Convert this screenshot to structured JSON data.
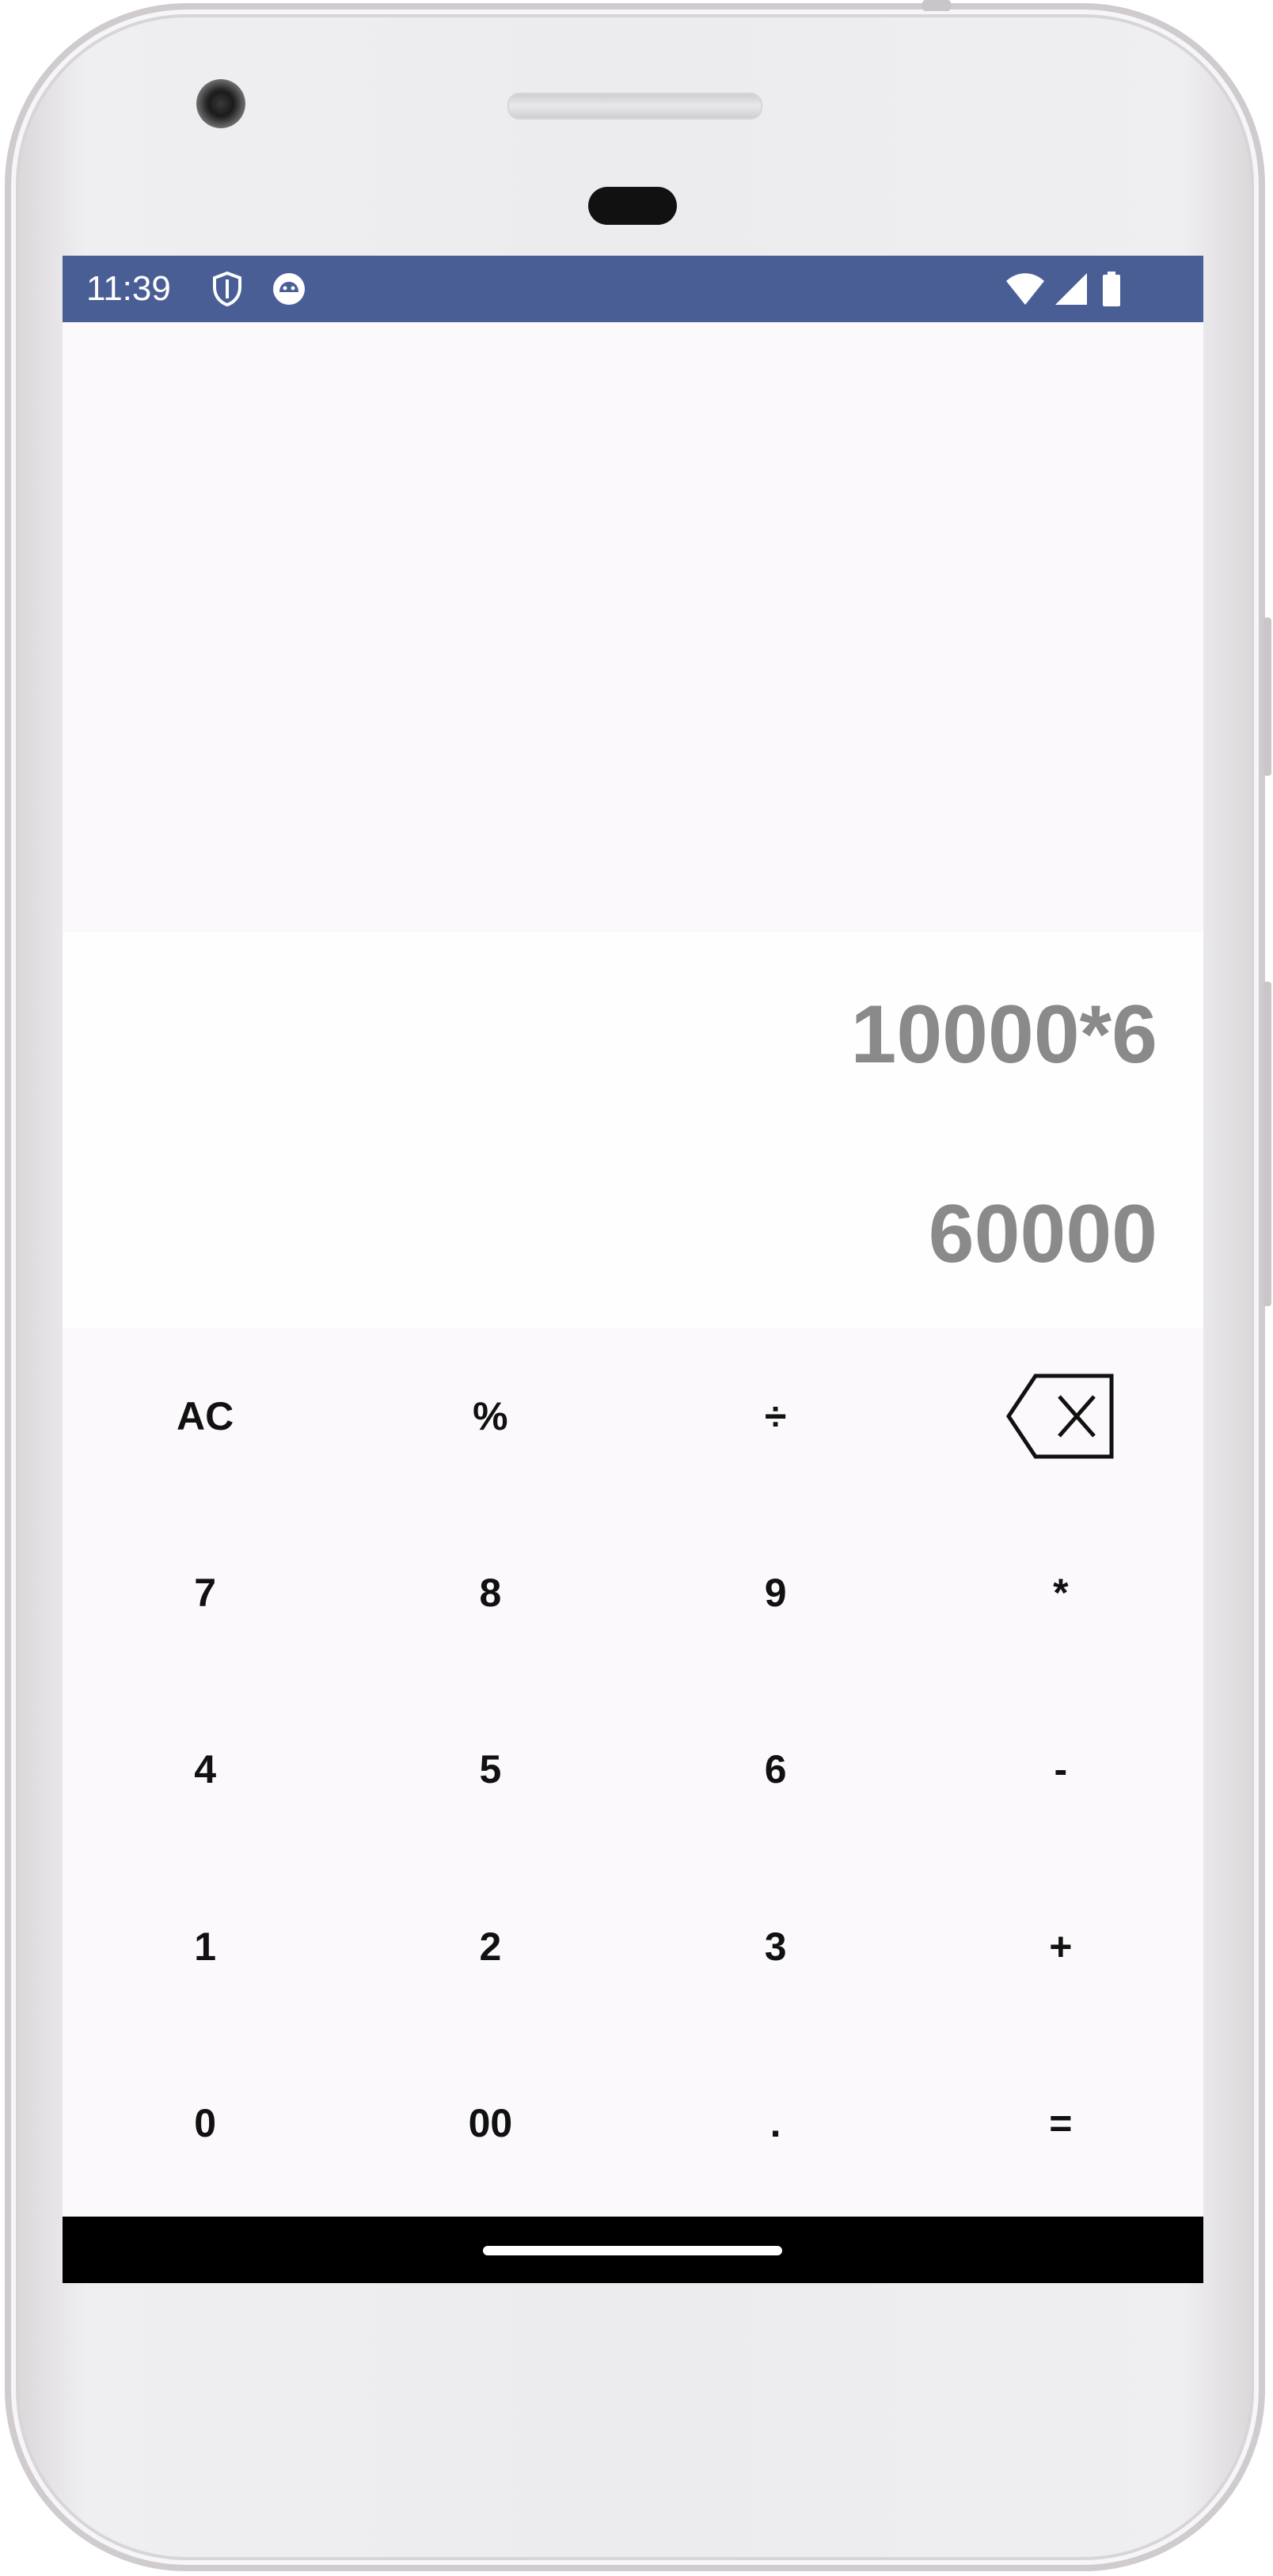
{
  "status_bar": {
    "time": "11:39",
    "left_icons": [
      "shield-icon",
      "android-debug-icon"
    ],
    "right_icons": [
      "wifi-icon",
      "cell-signal-icon",
      "battery-icon"
    ],
    "color": "#4a5e96"
  },
  "display": {
    "expression": "10000*6",
    "result": "60000",
    "text_color": "#8a8a8a"
  },
  "keypad": {
    "rows": [
      [
        "AC",
        "%",
        "÷",
        "backspace-icon"
      ],
      [
        "7",
        "8",
        "9",
        "*"
      ],
      [
        "4",
        "5",
        "6",
        "-"
      ],
      [
        "1",
        "2",
        "3",
        "+"
      ],
      [
        "0",
        "00",
        ".",
        "="
      ]
    ],
    "labels": {
      "ac": "AC",
      "percent": "%",
      "divide": "÷",
      "seven": "7",
      "eight": "8",
      "nine": "9",
      "multiply": "*",
      "four": "4",
      "five": "5",
      "six": "6",
      "minus": "-",
      "one": "1",
      "two": "2",
      "three": "3",
      "plus": "+",
      "zero": "0",
      "double_zero": "00",
      "decimal": ".",
      "equals": "="
    }
  }
}
